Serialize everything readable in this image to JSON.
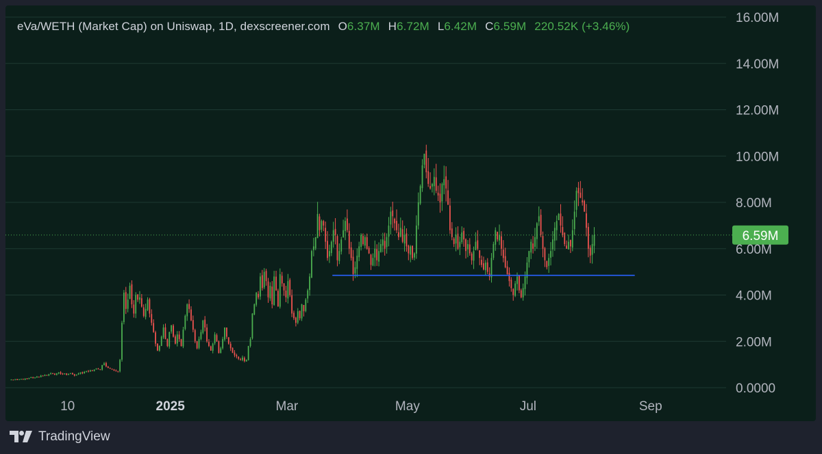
{
  "header": {
    "symbol_text": "eVa/WETH (Market Cap) on Uniswap, 1D, dexscreener.com",
    "open_key": "O",
    "open_value": "6.37M",
    "high_key": "H",
    "high_value": "6.72M",
    "low_key": "L",
    "low_value": "6.42M",
    "close_key": "C",
    "close_value": "6.59M",
    "change_value": "220.52K (+3.46%)"
  },
  "colors": {
    "background": "#0b1f1a",
    "up": "#4caf50",
    "down": "#ef5350",
    "grid": "#1e3a33",
    "support_line": "#2962ff",
    "badge": "#4caf50"
  },
  "price_badge": "6.59M",
  "brand": {
    "name": "TradingView",
    "logo_icon": "tradingview-logo-icon"
  },
  "chart_data": {
    "type": "candlestick",
    "title": "eVa/WETH (Market Cap) on Uniswap, 1D, dexscreener.com",
    "xlabel": "",
    "ylabel": "",
    "ylim": [
      0,
      16000000
    ],
    "y_ticks": [
      "16.00M",
      "14.00M",
      "12.00M",
      "10.00M",
      "8.00M",
      "6.00M",
      "4.00M",
      "2.00M",
      "0.0000"
    ],
    "y_tick_values": [
      16000000,
      14000000,
      12000000,
      10000000,
      8000000,
      6000000,
      4000000,
      2000000,
      0
    ],
    "x_ticks": [
      "10",
      "2025",
      "Mar",
      "May",
      "Jul",
      "Sep"
    ],
    "x_tick_dates": [
      "2024-11-10",
      "2025-01-01",
      "2025-03-01",
      "2025-05-01",
      "2025-07-01",
      "2025-09-01"
    ],
    "x_range": [
      "2024-10-12",
      "2025-09-20"
    ],
    "grid": true,
    "last_close": 6590000,
    "support_level": {
      "value": 4850000,
      "start": "2025-03-24",
      "end": "2025-08-24"
    },
    "series": [
      {
        "name": "",
        "comment": "approximate daily closes read from the chart",
        "start_date": "2024-10-12",
        "closes": [
          0.35,
          0.34,
          0.37,
          0.33,
          0.36,
          0.38,
          0.35,
          0.4,
          0.37,
          0.42,
          0.45,
          0.41,
          0.44,
          0.48,
          0.46,
          0.52,
          0.5,
          0.55,
          0.53,
          0.58,
          0.62,
          0.6,
          0.56,
          0.62,
          0.66,
          0.6,
          0.58,
          0.62,
          0.55,
          0.59,
          0.63,
          0.57,
          0.52,
          0.56,
          0.61,
          0.66,
          0.62,
          0.68,
          0.72,
          0.7,
          0.75,
          0.72,
          0.78,
          0.83,
          0.8,
          0.78,
          0.98,
          1.05,
          0.92,
          0.85,
          0.82,
          0.78,
          0.74,
          0.72,
          0.7,
          1.2,
          2.8,
          4.1,
          3.4,
          3.8,
          4.4,
          3.6,
          3.2,
          4.0,
          3.8,
          3.9,
          3.5,
          3.1,
          3.4,
          3.8,
          3.2,
          2.8,
          2.4,
          1.9,
          1.6,
          1.8,
          2.2,
          2.6,
          2.1,
          1.8,
          2.4,
          2.7,
          2.2,
          1.9,
          2.3,
          2.1,
          1.8,
          2.5,
          3.1,
          3.6,
          3.4,
          2.9,
          2.5,
          2.0,
          1.7,
          2.1,
          2.4,
          2.9,
          2.6,
          2.0,
          1.8,
          1.6,
          1.9,
          2.3,
          2.0,
          1.5,
          1.7,
          2.1,
          2.6,
          2.2,
          1.9,
          1.7,
          1.5,
          1.4,
          1.35,
          1.25,
          1.2,
          1.3,
          1.15,
          1.2,
          1.8,
          2.1,
          3.2,
          3.6,
          4.1,
          3.9,
          4.8,
          4.3,
          5.0,
          4.6,
          3.9,
          4.4,
          3.6,
          4.8,
          4.2,
          3.5,
          4.9,
          4.5,
          4.2,
          3.9,
          4.6,
          4.0,
          3.2,
          3.0,
          2.8,
          3.3,
          3.0,
          3.6,
          3.3,
          3.8,
          4.2,
          4.8,
          5.9,
          6.1,
          6.5,
          7.5,
          6.8,
          7.2,
          7.0,
          6.3,
          5.6,
          5.9,
          6.3,
          6.8,
          6.6,
          5.5,
          5.9,
          6.4,
          6.8,
          7.2,
          6.8,
          6.0,
          5.6,
          4.9,
          5.2,
          5.7,
          6.1,
          6.6,
          6.2,
          6.5,
          6.0,
          5.8,
          5.3,
          5.6,
          6.0,
          5.5,
          5.9,
          6.2,
          6.4,
          6.0,
          6.5,
          7.0,
          7.6,
          7.4,
          7.1,
          6.8,
          6.5,
          6.9,
          6.3,
          6.6,
          6.1,
          5.8,
          6.1,
          5.6,
          5.8,
          7.0,
          8.0,
          8.7,
          9.6,
          10.1,
          9.3,
          8.8,
          8.6,
          8.8,
          9.1,
          8.5,
          8.3,
          8.0,
          8.8,
          9.0,
          8.6,
          7.9,
          6.8,
          6.5,
          6.2,
          6.6,
          6.0,
          6.3,
          6.7,
          6.4,
          5.9,
          6.2,
          5.8,
          5.5,
          5.9,
          6.3,
          6.0,
          5.6,
          5.3,
          5.1,
          5.4,
          5.0,
          4.8,
          5.6,
          6.2,
          6.8,
          6.4,
          6.6,
          6.0,
          5.6,
          5.2,
          4.9,
          4.6,
          4.3,
          4.0,
          4.5,
          4.8,
          4.2,
          3.9,
          4.3,
          4.8,
          5.4,
          5.9,
          6.3,
          6.0,
          6.5,
          7.1,
          7.4,
          6.6,
          6.0,
          5.5,
          5.2,
          5.6,
          5.9,
          6.4,
          6.9,
          7.2,
          7.5,
          7.0,
          6.6,
          6.2,
          6.0,
          6.3,
          6.1,
          6.8,
          7.6,
          8.5,
          8.4,
          8.2,
          8.0,
          7.6,
          6.9,
          6.0,
          5.7,
          6.2,
          6.59
        ]
      }
    ]
  }
}
